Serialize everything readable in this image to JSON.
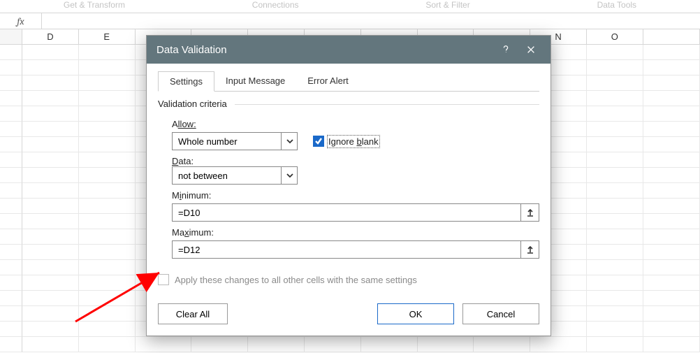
{
  "ribbon": {
    "group1": "Get & Transform",
    "group2": "Connections",
    "group3": "Sort & Filter",
    "group4": "Data Tools"
  },
  "formula_bar": {
    "fx_label": "fx",
    "value": ""
  },
  "columns": [
    "D",
    "E",
    "",
    "",
    "",
    "",
    "",
    "",
    "",
    "N",
    "O",
    ""
  ],
  "dialog": {
    "title": "Data Validation",
    "tabs": {
      "settings": "Settings",
      "input_message": "Input Message",
      "error_alert": "Error Alert"
    },
    "criteria_title": "Validation criteria",
    "allow_label_pre": "A",
    "allow_label_post": "llow:",
    "allow_value": "Whole number",
    "ignore_blank_pre": "Ignore ",
    "ignore_blank_u": "b",
    "ignore_blank_post": "lank",
    "data_label_u": "D",
    "data_label_post": "ata:",
    "data_value": "not between",
    "minimum_label_pre": "M",
    "minimum_label_u": "i",
    "minimum_label_post": "nimum:",
    "minimum_value": "=D10",
    "maximum_label_pre": "Ma",
    "maximum_label_u": "x",
    "maximum_label_post": "imum:",
    "maximum_value": "=D12",
    "apply_all_label": "Apply these changes to all other cells with the same settings",
    "clear_all": "Clear All",
    "ok": "OK",
    "cancel": "Cancel"
  }
}
